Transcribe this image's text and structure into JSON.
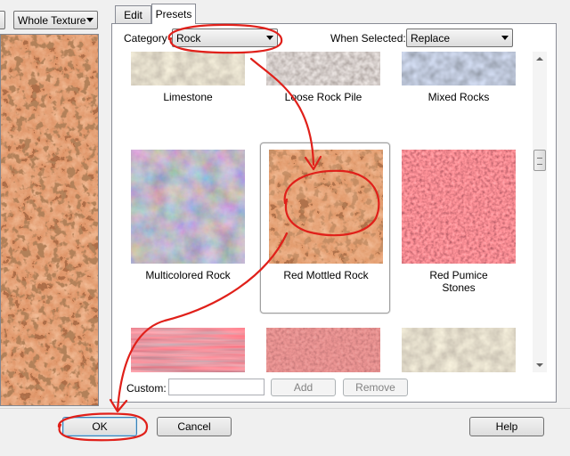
{
  "left": {
    "view_select": "Whole Texture"
  },
  "tabs": [
    {
      "label": "Edit"
    },
    {
      "label": "Presets"
    }
  ],
  "presets": {
    "category_label": "Category",
    "category_value": "Rock",
    "when_selected_label": "When Selected:",
    "when_selected_value": "Replace",
    "items": [
      {
        "name": "Limestone"
      },
      {
        "name": "Loose Rock Pile"
      },
      {
        "name": "Mixed Rocks"
      },
      {
        "name": "Multicolored Rock"
      },
      {
        "name": "Red Mottled Rock",
        "selected": true
      },
      {
        "name": "Red Pumice Stones"
      }
    ],
    "custom_label": "Custom:",
    "custom_value": "",
    "add_label": "Add",
    "remove_label": "Remove"
  },
  "footer": {
    "ok_label": "OK",
    "cancel_label": "Cancel",
    "help_label": "Help"
  },
  "colors": {
    "annotation": "#e0201a",
    "selection_border": "#a0a0a0"
  }
}
